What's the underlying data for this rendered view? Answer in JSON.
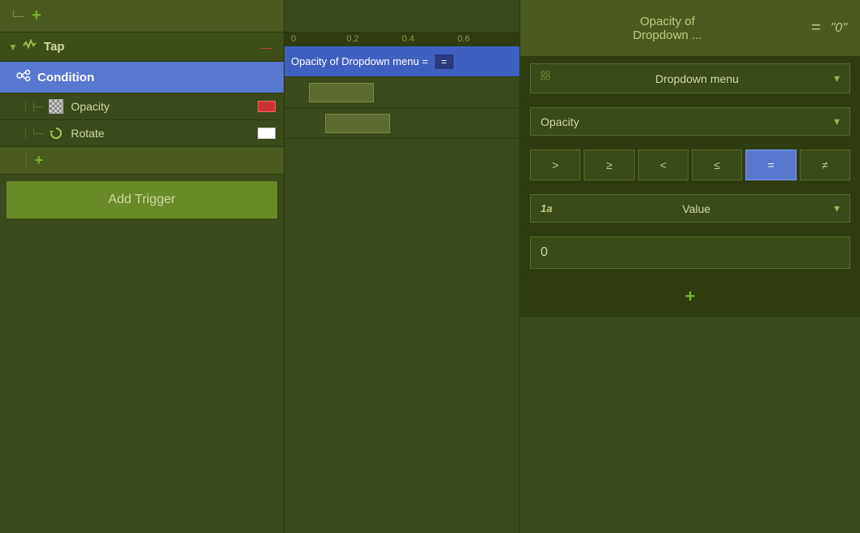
{
  "top_add": {
    "plus_label": "+"
  },
  "tap_row": {
    "label": "Tap",
    "dash": "—"
  },
  "condition_row": {
    "label": "Condition"
  },
  "opacity_row": {
    "label": "Opacity"
  },
  "rotate_row": {
    "label": "Rotate"
  },
  "plus_row": {
    "plus_label": "+"
  },
  "add_trigger": {
    "label": "Add Trigger"
  },
  "timeline": {
    "ticks": [
      "0",
      "0.2",
      "0.4",
      "0.6"
    ],
    "condition_text": "Opacity of Dropdown menu =",
    "equals_badge": "=",
    "value_badge": ""
  },
  "right_panel": {
    "header": {
      "main_text": "Opacity of\nDropdown ...",
      "equals": "=",
      "value": "\"0\""
    },
    "dropdown_menu": {
      "icon": "⋮⋮",
      "label": "Dropdown menu",
      "arrow": "▾"
    },
    "property_dropdown": {
      "label": "Opacity",
      "arrow": "▾"
    },
    "operators": [
      {
        "symbol": ">",
        "active": false
      },
      {
        "symbol": "≥",
        "active": false
      },
      {
        "symbol": "<",
        "active": false
      },
      {
        "symbol": "≤",
        "active": false
      },
      {
        "symbol": "=",
        "active": true
      },
      {
        "symbol": "≠",
        "active": false
      }
    ],
    "value_type": {
      "icon": "1a",
      "label": "Value",
      "arrow": "▾"
    },
    "value_input": "0",
    "add_btn": "+"
  }
}
